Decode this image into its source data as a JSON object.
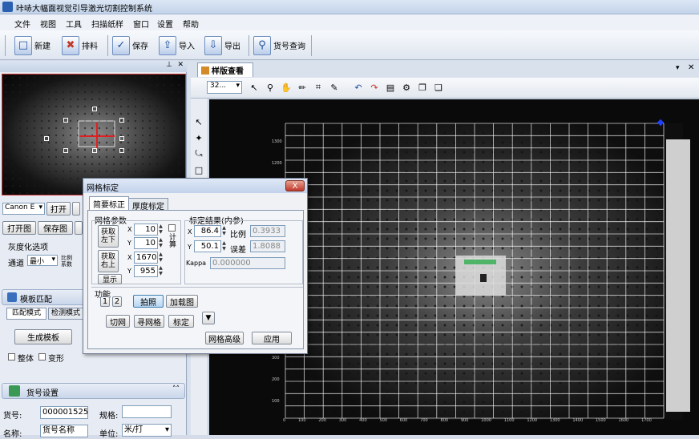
{
  "window": {
    "title": "咔哧大幅面视觉引导激光切割控制系统"
  },
  "menu": [
    "文件",
    "视图",
    "工具",
    "扫描纸样",
    "窗口",
    "设置",
    "帮助"
  ],
  "toolbar": [
    {
      "label": "新建",
      "icon": "new-file-icon"
    },
    {
      "label": "排料",
      "icon": "nesting-icon"
    },
    {
      "label": "保存",
      "icon": "save-icon"
    },
    {
      "label": "导入",
      "icon": "import-icon"
    },
    {
      "label": "导出",
      "icon": "export-icon"
    },
    {
      "label": "货号查询",
      "icon": "search-icon"
    }
  ],
  "left": {
    "camera_select": "Canon E",
    "open_btn": "打开",
    "open_img_btn": "打开图",
    "save_img_btn": "保存图",
    "gray_title": "灰度化选项",
    "channel_label": "通道",
    "channel_value": "最小",
    "template_section": "模板匹配",
    "tab_match": "匹配模式",
    "tab_detect": "检测模式",
    "gen_template": "生成模板",
    "whole": "整体",
    "deform": "变形",
    "goods_section": "货号设置",
    "goods_no_label": "货号:",
    "goods_no_value": "000001525",
    "spec_label": "规格:",
    "name_label": "名称:",
    "name_value": "货号名称",
    "unit_label": "单位:",
    "unit_value": "米/打"
  },
  "document": {
    "tab_title": "样版查看",
    "zoom": "32..."
  },
  "dialog": {
    "title": "网格标定",
    "tab1": "简要标正",
    "tab2": "厚度标定",
    "grid_params": "网格参数",
    "btn_left_bottom": "获取左下",
    "btn_right_top": "获取右上",
    "show_btn": "显示",
    "x1": "10",
    "y1": "10",
    "x2": "1670",
    "y2": "955",
    "calc_label": "计算",
    "result_title": "标定结果(内参)",
    "rx": "86.4",
    "ry": "50.1",
    "ratio_label": "比例",
    "ratio_value": "0.3933",
    "err_label": "误差",
    "err_value": "1.8088",
    "kappa_label": "Kappa",
    "kappa_value": "0.000000",
    "func_label": "功能",
    "page1": "1",
    "page2": "2",
    "capture_btn": "拍照",
    "load_img_btn": "加载图",
    "cut_net_btn": "切网",
    "find_net_btn": "寻网格",
    "calib_btn": "标定",
    "advanced_btn": "网格高级",
    "apply_btn": "应用",
    "close": "X"
  },
  "colors": {
    "accent": "#2b5fb0",
    "cross": "#e02020"
  }
}
